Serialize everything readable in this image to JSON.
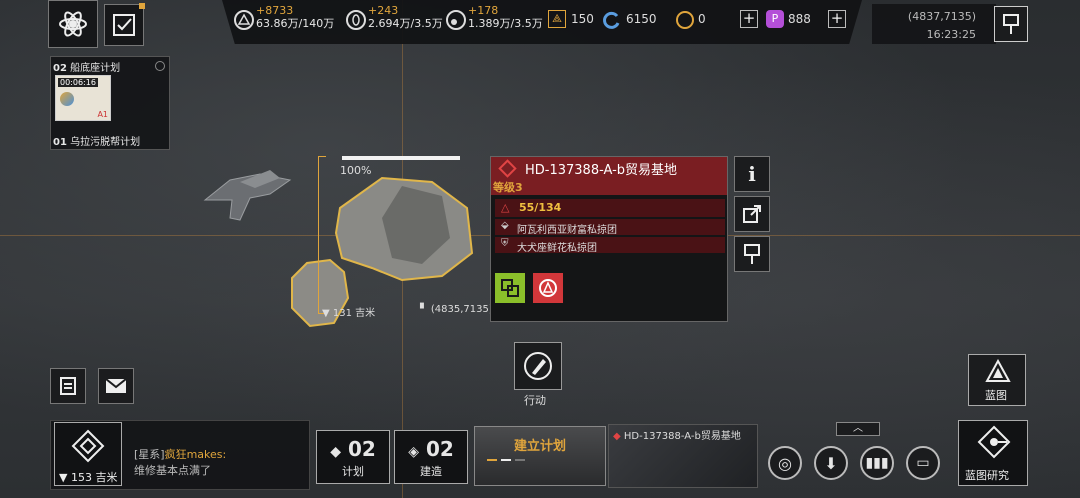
{
  "top_left": {
    "btn1_icon": "atom-icon",
    "btn2_icon": "checklist-icon"
  },
  "tasks": [
    {
      "num": "02",
      "name": "船底座计划",
      "timer": "00:06:16",
      "badge": "A1"
    },
    {
      "num": "01",
      "name": "乌拉污脱帮计划"
    }
  ],
  "resources": [
    {
      "inc": "+8733",
      "amt": "63.86万/140万",
      "icon": "triangle-resource-icon"
    },
    {
      "inc": "+243",
      "amt": "2.694万/3.5万",
      "icon": "crystal-resource-icon"
    },
    {
      "inc": "+178",
      "amt": "1.389万/3.5万",
      "icon": "gas-resource-icon"
    }
  ],
  "stats": {
    "fleet": "150",
    "blue": "6150",
    "gold": "0",
    "premium": "888"
  },
  "coords_top": {
    "pos": "(4837,7135)",
    "time": "16:23:25"
  },
  "target": {
    "health_pct": "100%",
    "distance": "131 吉米",
    "coords": "(4835,7135)",
    "title": "HD-137388-A-b贸易基地",
    "level": "等级3",
    "strength": "55/134",
    "org1": "阿瓦利西亚财富私掠团",
    "org2": "大犬座鲜花私掠团"
  },
  "action": {
    "label": "行动"
  },
  "blueprint": {
    "label": "蓝图"
  },
  "chat": {
    "channel": "[星系]",
    "user": "疯狂makes:",
    "msg": "维修基本点满了"
  },
  "bottom": {
    "distance": "153 吉米",
    "plan_count": "02",
    "plan_label": "计划",
    "build_count": "02",
    "build_label": "建造",
    "create_plan": "建立计划",
    "thumb_title": "HD-137388-A-b贸易基地",
    "research": "蓝图研究"
  },
  "colors": {
    "accent": "#e0a53c",
    "red_panel": "#7a1e22",
    "strength": "#f0c040",
    "green_icon": "#8bbf2a",
    "red_icon": "#d2373a"
  }
}
